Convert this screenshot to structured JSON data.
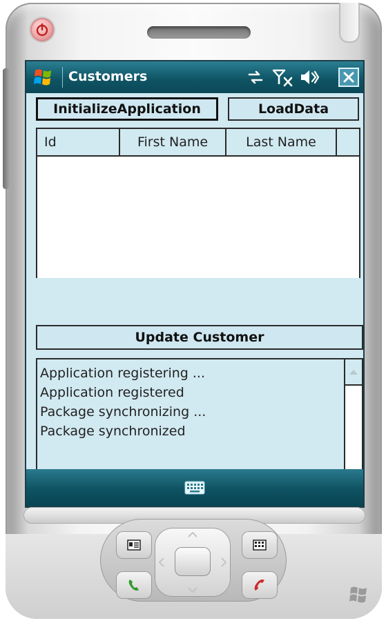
{
  "window": {
    "title": "Customers"
  },
  "title_bar_icons": [
    "start-menu-icon",
    "connectivity-icon",
    "signal-off-icon",
    "volume-icon",
    "close-icon"
  ],
  "buttons": {
    "initialize": "InitializeApplication",
    "load_data": "LoadData",
    "update_customer": "Update Customer"
  },
  "grid": {
    "columns": [
      "Id",
      "First Name",
      "Last Name",
      ""
    ],
    "rows": []
  },
  "log": {
    "lines": [
      "Application registering ...",
      "Application registered",
      "Package synchronizing ...",
      "Package synchronized"
    ]
  },
  "menu_bar": {
    "icon": "keyboard-icon"
  },
  "colors": {
    "title_bar": "#0f5565",
    "content_background": "#d1e9f1",
    "call_green": "#2f9a2f",
    "end_call_red": "#cc2b2b"
  }
}
